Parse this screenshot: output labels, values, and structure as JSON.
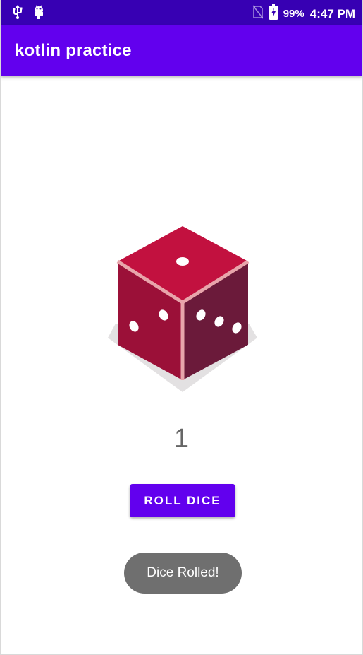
{
  "status_bar": {
    "icons_left": [
      "usb-icon",
      "android-debug-icon"
    ],
    "icons_right": [
      "no-sim-icon",
      "battery-charging-icon"
    ],
    "battery": "99%",
    "time": "4:47 PM",
    "background": "#3700b3"
  },
  "app_bar": {
    "title": "kotlin practice",
    "background": "#6200ee"
  },
  "dice": {
    "icon": "dice-icon",
    "colors": {
      "top": "#c2113f",
      "left": "#9b1038",
      "right": "#6b1a3a",
      "edge": "#e8a5ab",
      "shadow": "#e3e1e2"
    }
  },
  "result": {
    "value": "1"
  },
  "roll_button": {
    "label": "ROLL DICE",
    "color": "#6200ee"
  },
  "toast": {
    "message": "Dice Rolled!"
  }
}
